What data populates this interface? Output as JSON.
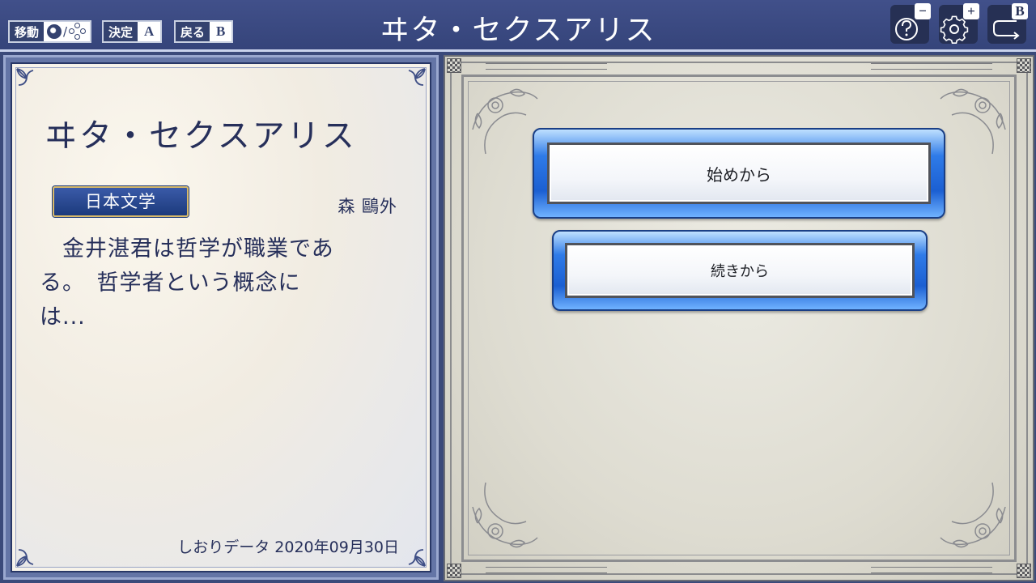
{
  "top_bar": {
    "hints": [
      {
        "label": "移動"
      },
      {
        "label": "決定",
        "key": "A"
      },
      {
        "label": "戻る",
        "key": "B"
      }
    ],
    "move_separator": "/",
    "title": "ヰタ・セクスアリス",
    "icons": [
      {
        "name": "help-icon",
        "key": "−"
      },
      {
        "name": "gear-icon",
        "key": "+"
      },
      {
        "name": "back-icon",
        "key": "B"
      }
    ]
  },
  "book": {
    "title": "ヰタ・セクスアリス",
    "genre": "日本文学",
    "author": "森 鷗外",
    "excerpt_lines": [
      "　金井湛君は哲学が職業であ",
      "る。　哲学者という概念に",
      "は..."
    ],
    "bookmark": "しおりデータ 2020年09月30日"
  },
  "menu": {
    "start_label": "始めから",
    "continue_label": "続きから"
  },
  "colors": {
    "topbar": "#3b4a7a",
    "accent_blue": "#1b5fd2",
    "text_navy": "#262f5a",
    "badge_gold": "#d7b96a"
  }
}
